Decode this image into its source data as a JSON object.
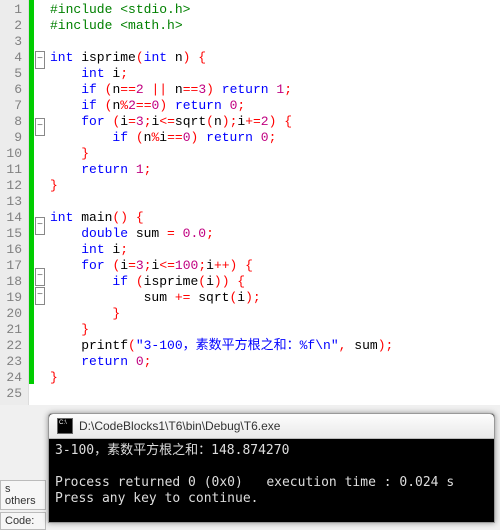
{
  "editor": {
    "lines": [
      {
        "n": 1,
        "change": true,
        "fold": null,
        "tokens": [
          [
            "pp",
            "#include <stdio.h>"
          ]
        ]
      },
      {
        "n": 2,
        "change": true,
        "fold": null,
        "tokens": [
          [
            "pp",
            "#include <math.h>"
          ]
        ]
      },
      {
        "n": 3,
        "change": true,
        "fold": null,
        "tokens": []
      },
      {
        "n": 4,
        "change": true,
        "fold": "open",
        "tokens": [
          [
            "kw",
            "int"
          ],
          [
            "txt",
            " isprime"
          ],
          [
            "op",
            "("
          ],
          [
            "kw",
            "int"
          ],
          [
            "txt",
            " n"
          ],
          [
            "op",
            ") {"
          ]
        ]
      },
      {
        "n": 5,
        "change": true,
        "fold": null,
        "tokens": [
          [
            "txt",
            "    "
          ],
          [
            "kw",
            "int"
          ],
          [
            "txt",
            " i"
          ],
          [
            "op",
            ";"
          ]
        ]
      },
      {
        "n": 6,
        "change": true,
        "fold": null,
        "tokens": [
          [
            "txt",
            "    "
          ],
          [
            "kw",
            "if"
          ],
          [
            "txt",
            " "
          ],
          [
            "op",
            "("
          ],
          [
            "txt",
            "n"
          ],
          [
            "op",
            "=="
          ],
          [
            "num",
            "2"
          ],
          [
            "txt",
            " "
          ],
          [
            "op",
            "||"
          ],
          [
            "txt",
            " n"
          ],
          [
            "op",
            "=="
          ],
          [
            "num",
            "3"
          ],
          [
            "op",
            ")"
          ],
          [
            "txt",
            " "
          ],
          [
            "kw",
            "return"
          ],
          [
            "txt",
            " "
          ],
          [
            "num",
            "1"
          ],
          [
            "op",
            ";"
          ]
        ]
      },
      {
        "n": 7,
        "change": true,
        "fold": null,
        "tokens": [
          [
            "txt",
            "    "
          ],
          [
            "kw",
            "if"
          ],
          [
            "txt",
            " "
          ],
          [
            "op",
            "("
          ],
          [
            "txt",
            "n"
          ],
          [
            "op",
            "%"
          ],
          [
            "num",
            "2"
          ],
          [
            "op",
            "=="
          ],
          [
            "num",
            "0"
          ],
          [
            "op",
            ")"
          ],
          [
            "txt",
            " "
          ],
          [
            "kw",
            "return"
          ],
          [
            "txt",
            " "
          ],
          [
            "num",
            "0"
          ],
          [
            "op",
            ";"
          ]
        ]
      },
      {
        "n": 8,
        "change": true,
        "fold": "open",
        "tokens": [
          [
            "txt",
            "    "
          ],
          [
            "kw",
            "for"
          ],
          [
            "txt",
            " "
          ],
          [
            "op",
            "("
          ],
          [
            "txt",
            "i"
          ],
          [
            "op",
            "="
          ],
          [
            "num",
            "3"
          ],
          [
            "op",
            ";"
          ],
          [
            "txt",
            "i"
          ],
          [
            "op",
            "<="
          ],
          [
            "txt",
            "sqrt"
          ],
          [
            "op",
            "("
          ],
          [
            "txt",
            "n"
          ],
          [
            "op",
            ");"
          ],
          [
            "txt",
            "i"
          ],
          [
            "op",
            "+="
          ],
          [
            "num",
            "2"
          ],
          [
            "op",
            ") {"
          ]
        ]
      },
      {
        "n": 9,
        "change": true,
        "fold": null,
        "tokens": [
          [
            "txt",
            "        "
          ],
          [
            "kw",
            "if"
          ],
          [
            "txt",
            " "
          ],
          [
            "op",
            "("
          ],
          [
            "txt",
            "n"
          ],
          [
            "op",
            "%"
          ],
          [
            "txt",
            "i"
          ],
          [
            "op",
            "=="
          ],
          [
            "num",
            "0"
          ],
          [
            "op",
            ")"
          ],
          [
            "txt",
            " "
          ],
          [
            "kw",
            "return"
          ],
          [
            "txt",
            " "
          ],
          [
            "num",
            "0"
          ],
          [
            "op",
            ";"
          ]
        ]
      },
      {
        "n": 10,
        "change": true,
        "fold": null,
        "tokens": [
          [
            "txt",
            "    "
          ],
          [
            "op",
            "}"
          ]
        ]
      },
      {
        "n": 11,
        "change": true,
        "fold": null,
        "tokens": [
          [
            "txt",
            "    "
          ],
          [
            "kw",
            "return"
          ],
          [
            "txt",
            " "
          ],
          [
            "num",
            "1"
          ],
          [
            "op",
            ";"
          ]
        ]
      },
      {
        "n": 12,
        "change": true,
        "fold": null,
        "tokens": [
          [
            "op",
            "}"
          ]
        ]
      },
      {
        "n": 13,
        "change": true,
        "fold": null,
        "tokens": []
      },
      {
        "n": 14,
        "change": true,
        "fold": "open",
        "tokens": [
          [
            "kw",
            "int"
          ],
          [
            "txt",
            " main"
          ],
          [
            "op",
            "() {"
          ]
        ]
      },
      {
        "n": 15,
        "change": true,
        "fold": null,
        "tokens": [
          [
            "txt",
            "    "
          ],
          [
            "kw",
            "double"
          ],
          [
            "txt",
            " sum "
          ],
          [
            "op",
            "="
          ],
          [
            "txt",
            " "
          ],
          [
            "num",
            "0.0"
          ],
          [
            "op",
            ";"
          ]
        ]
      },
      {
        "n": 16,
        "change": true,
        "fold": null,
        "tokens": [
          [
            "txt",
            "    "
          ],
          [
            "kw",
            "int"
          ],
          [
            "txt",
            " i"
          ],
          [
            "op",
            ";"
          ]
        ]
      },
      {
        "n": 17,
        "change": true,
        "fold": "open",
        "tokens": [
          [
            "txt",
            "    "
          ],
          [
            "kw",
            "for"
          ],
          [
            "txt",
            " "
          ],
          [
            "op",
            "("
          ],
          [
            "txt",
            "i"
          ],
          [
            "op",
            "="
          ],
          [
            "num",
            "3"
          ],
          [
            "op",
            ";"
          ],
          [
            "txt",
            "i"
          ],
          [
            "op",
            "<="
          ],
          [
            "num",
            "100"
          ],
          [
            "op",
            ";"
          ],
          [
            "txt",
            "i"
          ],
          [
            "op",
            "++) {"
          ]
        ]
      },
      {
        "n": 18,
        "change": true,
        "fold": "open",
        "tokens": [
          [
            "txt",
            "        "
          ],
          [
            "kw",
            "if"
          ],
          [
            "txt",
            " "
          ],
          [
            "op",
            "("
          ],
          [
            "txt",
            "isprime"
          ],
          [
            "op",
            "("
          ],
          [
            "txt",
            "i"
          ],
          [
            "op",
            ")) {"
          ]
        ]
      },
      {
        "n": 19,
        "change": true,
        "fold": null,
        "tokens": [
          [
            "txt",
            "            sum "
          ],
          [
            "op",
            "+="
          ],
          [
            "txt",
            " sqrt"
          ],
          [
            "op",
            "("
          ],
          [
            "txt",
            "i"
          ],
          [
            "op",
            ");"
          ]
        ]
      },
      {
        "n": 20,
        "change": true,
        "fold": null,
        "tokens": [
          [
            "txt",
            "        "
          ],
          [
            "op",
            "}"
          ]
        ]
      },
      {
        "n": 21,
        "change": true,
        "fold": null,
        "tokens": [
          [
            "txt",
            "    "
          ],
          [
            "op",
            "}"
          ]
        ]
      },
      {
        "n": 22,
        "change": true,
        "fold": null,
        "tokens": [
          [
            "txt",
            "    printf"
          ],
          [
            "op",
            "("
          ],
          [
            "str",
            "\"3-100，素数平方根之和：%f\\n\""
          ],
          [
            "op",
            ","
          ],
          [
            "txt",
            " sum"
          ],
          [
            "op",
            ");"
          ]
        ]
      },
      {
        "n": 23,
        "change": true,
        "fold": null,
        "tokens": [
          [
            "txt",
            "    "
          ],
          [
            "kw",
            "return"
          ],
          [
            "txt",
            " "
          ],
          [
            "num",
            "0"
          ],
          [
            "op",
            ";"
          ]
        ]
      },
      {
        "n": 24,
        "change": true,
        "fold": null,
        "tokens": [
          [
            "op",
            "}"
          ]
        ]
      },
      {
        "n": 25,
        "change": false,
        "fold": null,
        "tokens": []
      }
    ]
  },
  "console": {
    "title": "D:\\CodeBlocks1\\T6\\bin\\Debug\\T6.exe",
    "output": "3-100，素数平方根之和：148.874270\n\nProcess returned 0 (0x0)   execution time : 0.024 s\nPress any key to continue."
  },
  "left_panel": {
    "tab1": "s others",
    "tab2": "Code:"
  }
}
